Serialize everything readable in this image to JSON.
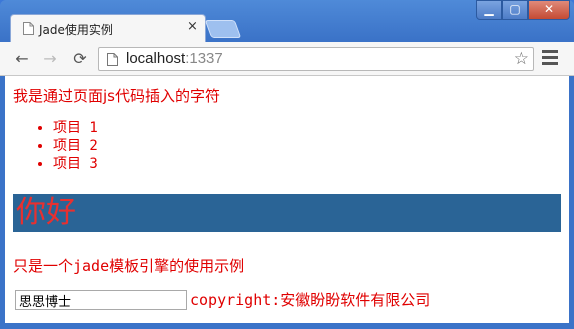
{
  "browser": {
    "tab_title": "Jade使用实例",
    "tab_close": "×",
    "url_host": "localhost",
    "url_port": ":1337",
    "window_min": "▁",
    "window_max": "▢",
    "window_close": "✕",
    "nav_back": "←",
    "nav_forward": "→",
    "nav_reload": "⟳",
    "star": "☆"
  },
  "page": {
    "intro_text": "我是通过页面js代码插入的字符",
    "list_items": [
      "项目 1",
      "项目 2",
      "项目 3"
    ],
    "banner_text": "你好",
    "description": "只是一个jade模板引擎的使用示例",
    "name_input_value": "思思博士",
    "copyright": "copyright:安徽盼盼软件有限公司"
  },
  "colors": {
    "text_red": "#e00000",
    "banner_bg": "#2a6496",
    "banner_text": "#e83030"
  }
}
